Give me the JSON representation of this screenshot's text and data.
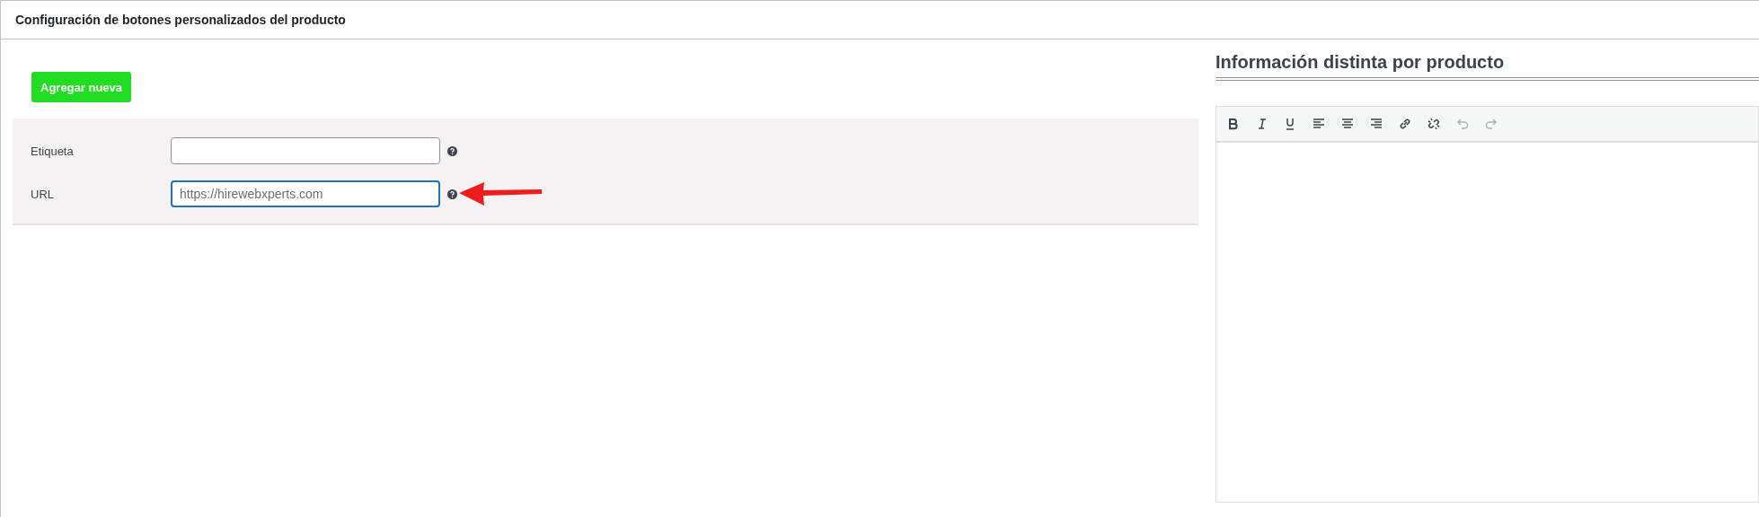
{
  "panel": {
    "title": "Configuración de botones personalizados del producto"
  },
  "add_button": {
    "label": "Agregar nueva"
  },
  "fields": [
    {
      "label": "Etiqueta",
      "focused": false,
      "help": true
    },
    {
      "label": "URL",
      "placeholder": "https://hirewebxperts.com",
      "focused": true,
      "help": true,
      "arrow": true
    }
  ],
  "editor": {
    "heading": "Información distinta por producto",
    "toolbar": [
      {
        "kind": "bold",
        "disabled": false
      },
      {
        "kind": "italic",
        "disabled": false
      },
      {
        "kind": "underline",
        "disabled": false
      },
      {
        "kind": "align-left",
        "disabled": false
      },
      {
        "kind": "align-center",
        "disabled": false
      },
      {
        "kind": "align-right",
        "disabled": false
      },
      {
        "kind": "link",
        "disabled": false
      },
      {
        "kind": "unlink",
        "disabled": false
      },
      {
        "kind": "undo",
        "disabled": true
      },
      {
        "kind": "redo",
        "disabled": true
      }
    ]
  }
}
